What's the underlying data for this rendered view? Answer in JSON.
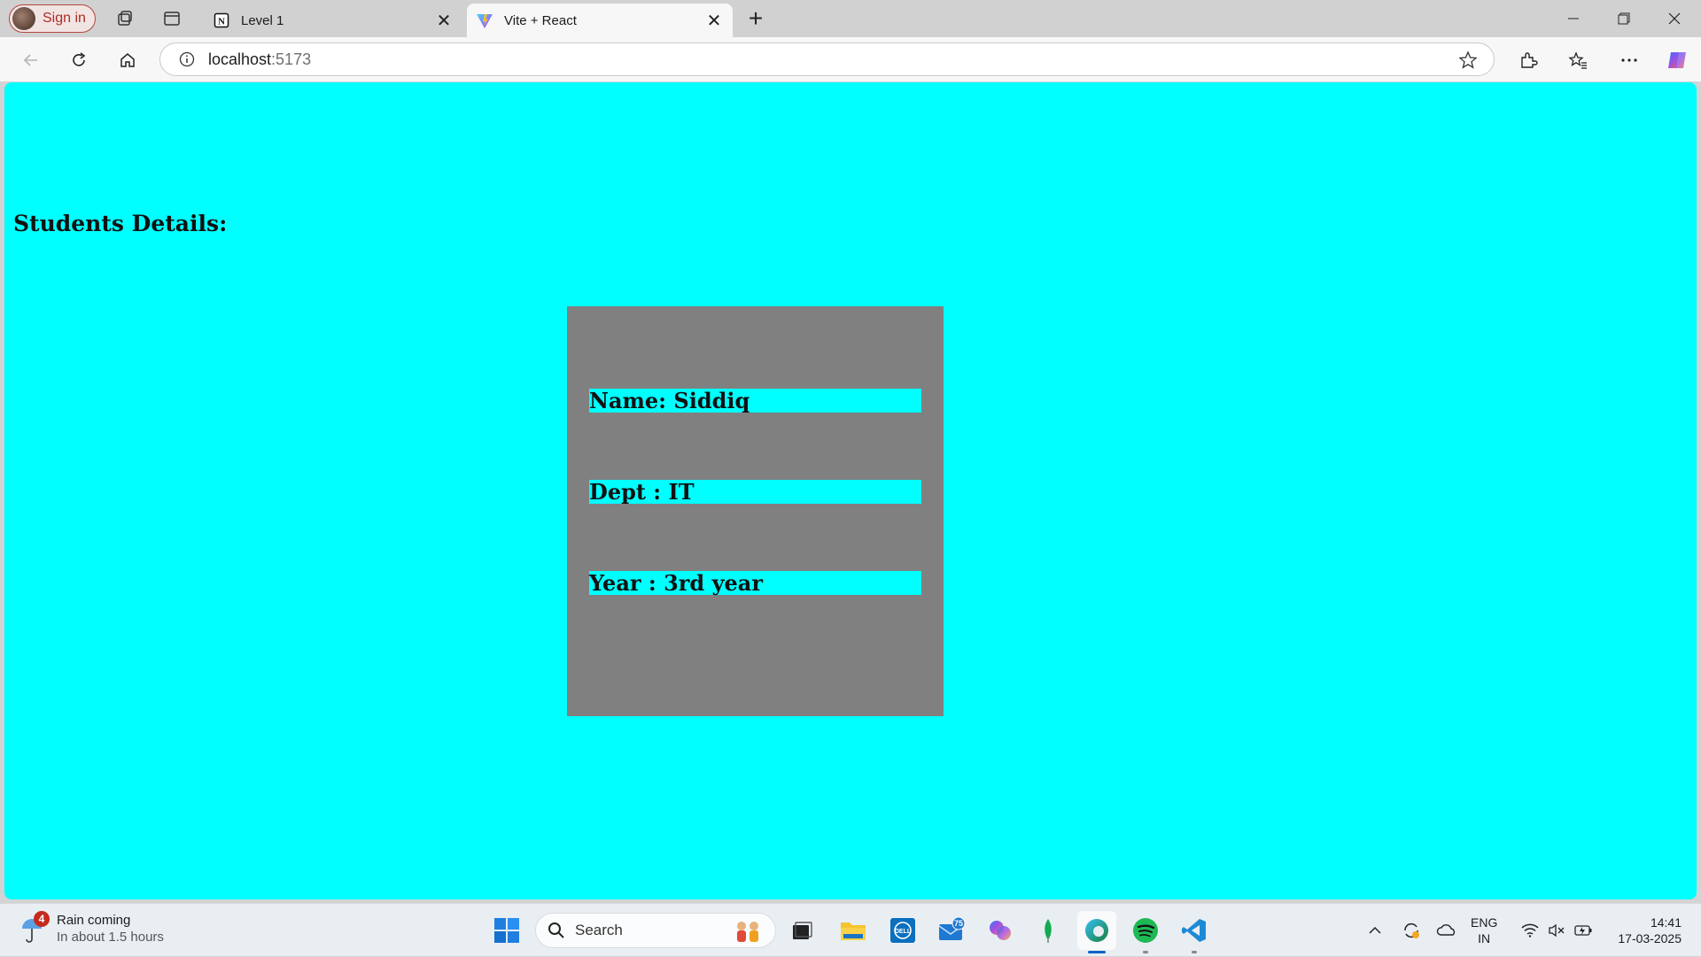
{
  "browser": {
    "signin_label": "Sign in",
    "tabs": [
      {
        "title": "Level 1",
        "favicon": "notion-icon",
        "active": false
      },
      {
        "title": "Vite + React",
        "favicon": "vite-icon",
        "active": true
      }
    ],
    "url_host": "localhost",
    "url_port": ":5173"
  },
  "page": {
    "heading": "Students Details:",
    "background": "#00ffff",
    "card_background": "#808080",
    "fields": [
      {
        "text": "Name: Siddiq"
      },
      {
        "text": "Dept : IT"
      },
      {
        "text": "Year : 3rd year"
      }
    ]
  },
  "taskbar": {
    "weather_badge": "4",
    "weather_title": "Rain coming",
    "weather_sub": "In about 1.5 hours",
    "search_label": "Search",
    "mail_badge": "75",
    "lang_line1": "ENG",
    "lang_line2": "IN",
    "time": "14:41",
    "date": "17-03-2025"
  }
}
